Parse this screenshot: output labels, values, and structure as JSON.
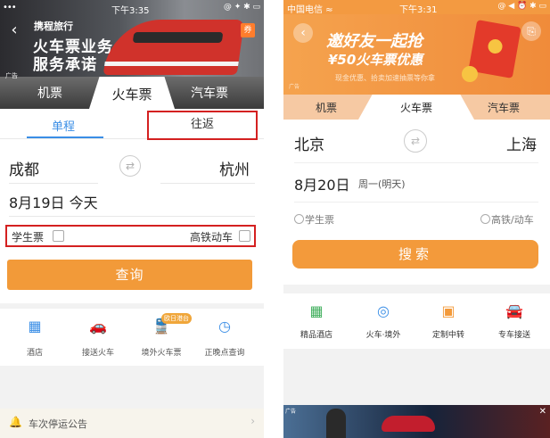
{
  "left": {
    "status": {
      "signal": "•••",
      "time": "下午3:35",
      "right": "@ ✦ ✱ ▭"
    },
    "banner": {
      "brand": "携程旅行",
      "slogan_line1": "火车票业务",
      "slogan_line2": "服务承诺",
      "ad_label": "广告",
      "badge": "券"
    },
    "tabs": [
      "机票",
      "火车票",
      "汽车票"
    ],
    "trip_tabs": [
      "单程",
      "往返"
    ],
    "from_city": "成都",
    "to_city": "杭州",
    "date": "8月19日 今天",
    "options": {
      "student": "学生票",
      "high_speed": "高铁动车"
    },
    "search_label": "查询",
    "services": [
      {
        "icon": "hotel-icon",
        "glyph": "▦",
        "label": "酒店"
      },
      {
        "icon": "car-icon",
        "glyph": "🚗",
        "label": "接送火车"
      },
      {
        "icon": "train-icon",
        "glyph": "🚆",
        "label": "境外火车票",
        "badge": "欧日港台"
      },
      {
        "icon": "clock-icon",
        "glyph": "◷",
        "label": "正晚点查询"
      }
    ],
    "notice": {
      "text": "车次停运公告",
      "glyph": "🔔",
      "arrow": "›"
    }
  },
  "right": {
    "status": {
      "carrier": "中国电信 ≈",
      "time": "下午3:31",
      "right": "@ ◀ ⏰ ✱ ▭"
    },
    "banner": {
      "title_line1": "邀好友一起抢",
      "title_line2": "¥50火车票优惠",
      "sub": "现金优惠、拾卖加速抽票等你拿",
      "ad_label": "广告",
      "back": "‹",
      "share": "⎘"
    },
    "tabs": [
      "机票",
      "火车票",
      "汽车票"
    ],
    "from_city": "北京",
    "to_city": "上海",
    "date": "8月20日",
    "weekday": "周一(明天)",
    "options": {
      "student": "学生票",
      "high_speed": "高铁/动车"
    },
    "search_label": "搜索",
    "services": [
      {
        "icon": "hotel-icon",
        "glyph": "▦",
        "label": "精品酒店",
        "color": "#3fae5b"
      },
      {
        "icon": "globe-train-icon",
        "glyph": "◎",
        "label": "火车·境外",
        "color": "#3a8ee6"
      },
      {
        "icon": "transfer-icon",
        "glyph": "▣",
        "label": "定制中转",
        "color": "#f39a3b"
      },
      {
        "icon": "car-icon",
        "glyph": "🚘",
        "label": "专车接送",
        "color": "#e8564a"
      }
    ],
    "ad": {
      "tag": "广告",
      "close": "✕"
    }
  },
  "colors": {
    "accent_orange": "#f29a39",
    "link_blue": "#3a8ee6",
    "highlight_red": "#d42020"
  },
  "common": {
    "swap_glyph": "⇄",
    "back_glyph": "‹"
  }
}
